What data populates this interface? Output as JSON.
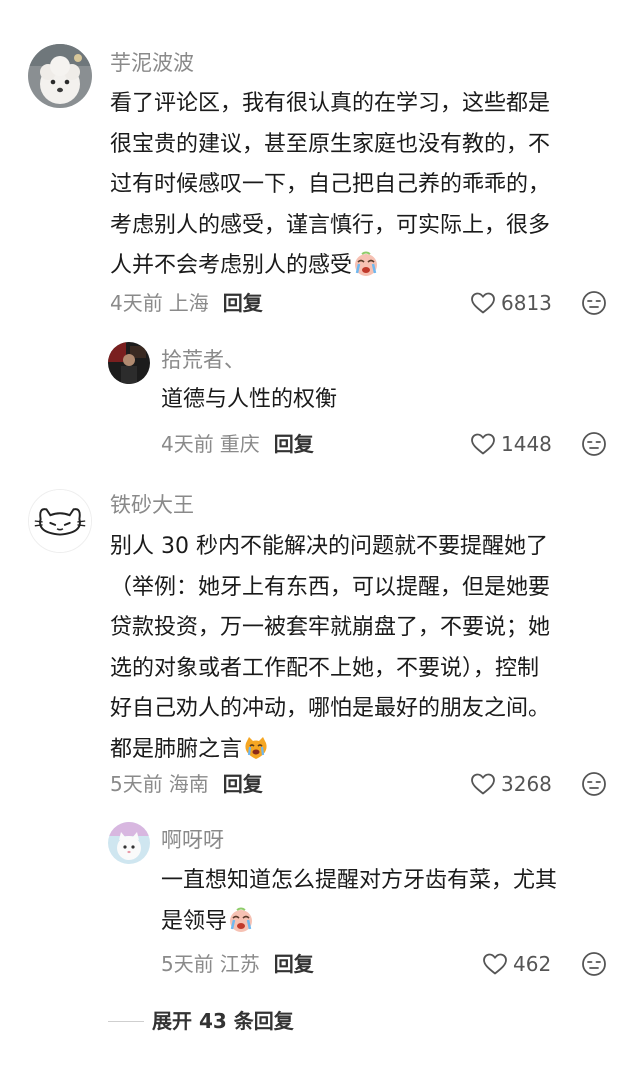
{
  "comments": [
    {
      "username": "芋泥波波",
      "lines": [
        "看了评论区，我有很认真的在学习，这些都是",
        "很宝贵的建议，甚至原生家庭也没有教的，不",
        "过有时候感叹一下，自己把自己养的乖乖的，",
        "考虑别人的感受，谨言慎行，可实际上，很多",
        "人并不会考虑别人的感受"
      ],
      "emoji": "crying-face-emoji",
      "time": "4天前",
      "location": "上海",
      "reply_label": "回复",
      "likes": "6813",
      "replies": [
        {
          "username": "拾荒者、",
          "lines": [
            "道德与人性的权衡"
          ],
          "time": "4天前",
          "location": "重庆",
          "reply_label": "回复",
          "likes": "1448"
        }
      ]
    },
    {
      "username": "铁砂大王",
      "lines": [
        "别人 30 秒内不能解决的问题就不要提醒她了",
        "（举例：她牙上有东西，可以提醒，但是她要",
        "贷款投资，万一被套牢就崩盘了，不要说；她",
        "选的对象或者工作配不上她，不要说），控制",
        "好自己劝人的冲动，哪怕是最好的朋友之间。",
        "都是肺腑之言"
      ],
      "emoji": "crying-cat-emoji",
      "time": "5天前",
      "location": "海南",
      "reply_label": "回复",
      "likes": "3268",
      "replies": [
        {
          "username": "啊呀呀",
          "lines": [
            "一直想知道怎么提醒对方牙齿有菜，尤其",
            "是领导"
          ],
          "emoji": "crying-face-emoji",
          "time": "5天前",
          "location": "江苏",
          "reply_label": "回复",
          "likes": "462"
        }
      ]
    }
  ],
  "expand_replies_label": "展开 43 条回复",
  "colors": {
    "username": "#8a8a8a",
    "text": "#1a1a1a",
    "meta": "#8a8a8a",
    "reply": "#333333",
    "icon": "#555555"
  }
}
